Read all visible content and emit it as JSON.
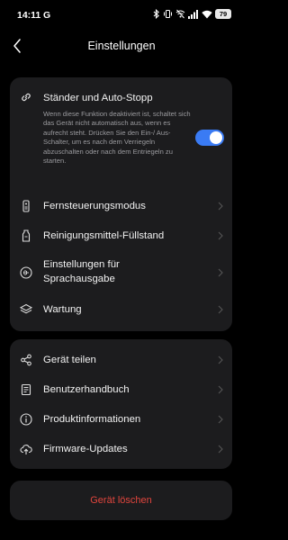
{
  "status_bar": {
    "time": "14:11",
    "notification_glyph": "G",
    "icons": [
      "bluetooth-icon",
      "vibrate-icon",
      "wifi-off-icon",
      "signal-icon",
      "wifi-icon"
    ],
    "battery_level": "79"
  },
  "header": {
    "back_icon": "back-arrow-icon",
    "title": "Einstellungen"
  },
  "card_1": {
    "feature": {
      "icon": "link-icon",
      "title": "Ständer und Auto-Stopp",
      "description": "Wenn diese Funktion deaktiviert ist, schaltet sich das Gerät nicht automatisch aus, wenn es aufrecht steht. Drücken Sie den Ein-/ Aus-Schalter, um es nach dem Verriegeln abzuschalten oder nach dem Entriegeln zu starten.",
      "toggle_on": true
    },
    "items": [
      {
        "icon": "remote-control-icon",
        "label": "Fernsteuerungsmodus"
      },
      {
        "icon": "bottle-icon",
        "label": "Reinigungsmittel-Füllstand"
      },
      {
        "icon": "voice-wave-icon",
        "label_line1": "Einstellungen für",
        "label_line2": "Sprachausgabe"
      },
      {
        "icon": "layers-icon",
        "label": "Wartung"
      }
    ]
  },
  "card_2": {
    "items": [
      {
        "icon": "share-icon",
        "label": "Gerät teilen"
      },
      {
        "icon": "manual-icon",
        "label": "Benutzerhandbuch"
      },
      {
        "icon": "info-icon",
        "label": "Produktinformationen"
      },
      {
        "icon": "upload-cloud-icon",
        "label": "Firmware-Updates"
      }
    ]
  },
  "card_3": {
    "delete_label": "Gerät löschen"
  },
  "colors": {
    "background": "#000000",
    "card": "#1c1c1e",
    "toggle_accent": "#3a7bf4",
    "danger": "#e0453d",
    "secondary_text": "#9a9a9e"
  }
}
